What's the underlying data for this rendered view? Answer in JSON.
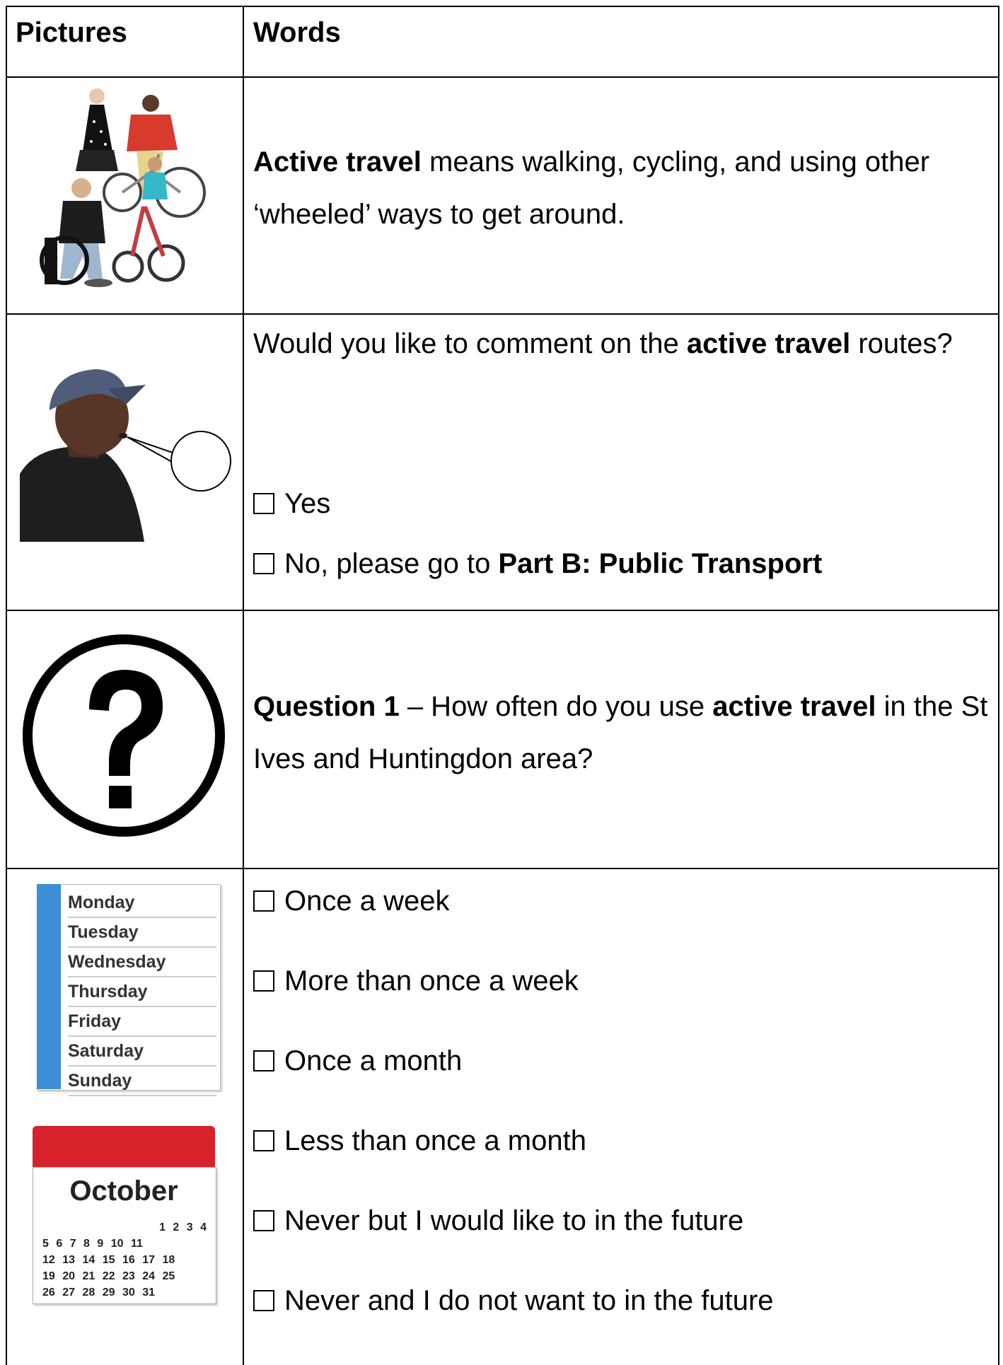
{
  "header": {
    "col_pictures": "Pictures",
    "col_words": "Words"
  },
  "row1": {
    "bold": "Active travel",
    "text": " means walking, cycling, and using other ‘wheeled’ ways to get around."
  },
  "row2": {
    "q_pre": "Would you like to comment on the ",
    "q_bold": "active travel",
    "q_post": " routes?",
    "opt_yes": "Yes",
    "opt_no_pre": "No, please go to ",
    "opt_no_bold": "Part B: Public Transport"
  },
  "row3": {
    "q_label": "Question 1",
    "q_mid": " – How often do you use ",
    "q_bold": "active travel",
    "q_post": " in the St Ives and Huntingdon area?"
  },
  "row4": {
    "options": [
      "Once a week",
      "More than once a week",
      "Once a month",
      "Less than once a month",
      "Never but I would like to in the future",
      "Never and I do not want to in the future"
    ],
    "diary_days": [
      "Monday",
      "Tuesday",
      "Wednesday",
      "Thursday",
      "Friday",
      "Saturday",
      "Sunday"
    ],
    "calendar_month": "October",
    "calendar_rows": [
      "1 2 3 4",
      "5 6 7 8 9 10 11",
      "12 13 14 15 16 17 18",
      "19 20 21 22 23 24 25",
      "26 27 28 29 30 31"
    ]
  },
  "icons": {
    "people_travel": "group-of-people-with-bikes-and-wheelchair-icon",
    "person_speaking": "person-speaking-icon",
    "question": "question-mark-icon",
    "diary": "weekly-diary-icon",
    "calendar": "calendar-icon"
  },
  "colors": {
    "calendar_red": "#d7222c",
    "diary_blue": "#3c8fd6",
    "border": "#000000"
  }
}
